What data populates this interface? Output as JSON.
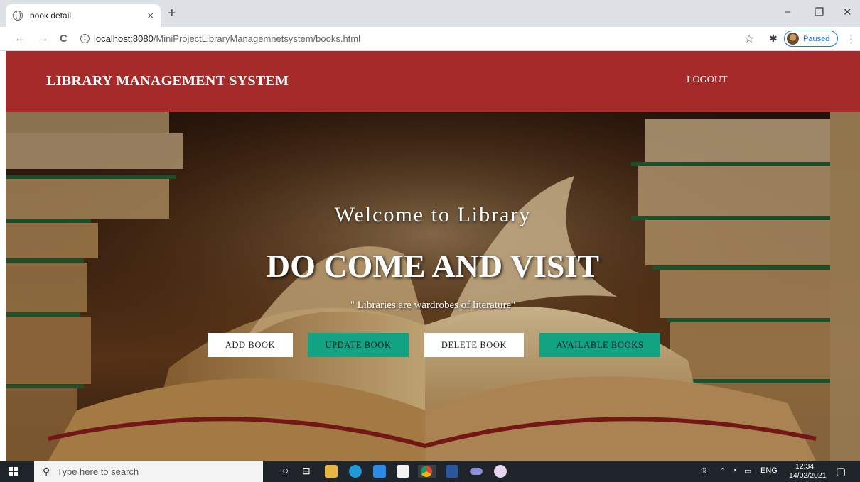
{
  "browser": {
    "tab_title": "book detail",
    "tab_close": "×",
    "new_tab": "+",
    "window_controls": {
      "minimize": "–",
      "restore": "❐",
      "close": "✕"
    },
    "nav": {
      "back": "←",
      "forward": "→",
      "reload": "C"
    },
    "url_host": "localhost:8080",
    "url_path": "/MiniProjectLibraryManagemnetsystem/books.html",
    "profile_status": "Paused",
    "menu": "⋮"
  },
  "header": {
    "brand": "LIBRARY MANAGEMENT SYSTEM",
    "logout": "LOGOUT"
  },
  "hero": {
    "welcome": "Welcome to Library",
    "headline": "DO COME AND VISIT",
    "quote": "\" Libraries are wardrobes of literature\"",
    "buttons": [
      {
        "label": "ADD BOOK",
        "style": "white"
      },
      {
        "label": "UPDATE BOOK",
        "style": "green"
      },
      {
        "label": "DELETE BOOK",
        "style": "white"
      },
      {
        "label": "AVAILABLE BOOKS",
        "style": "green"
      }
    ]
  },
  "taskbar": {
    "search_placeholder": "Type here to search",
    "language": "ENG",
    "time": "12:34",
    "date": "14/02/2021"
  },
  "colors": {
    "header_bg": "#a52a2a",
    "button_green": "#12a383",
    "button_white": "#ffffff"
  }
}
